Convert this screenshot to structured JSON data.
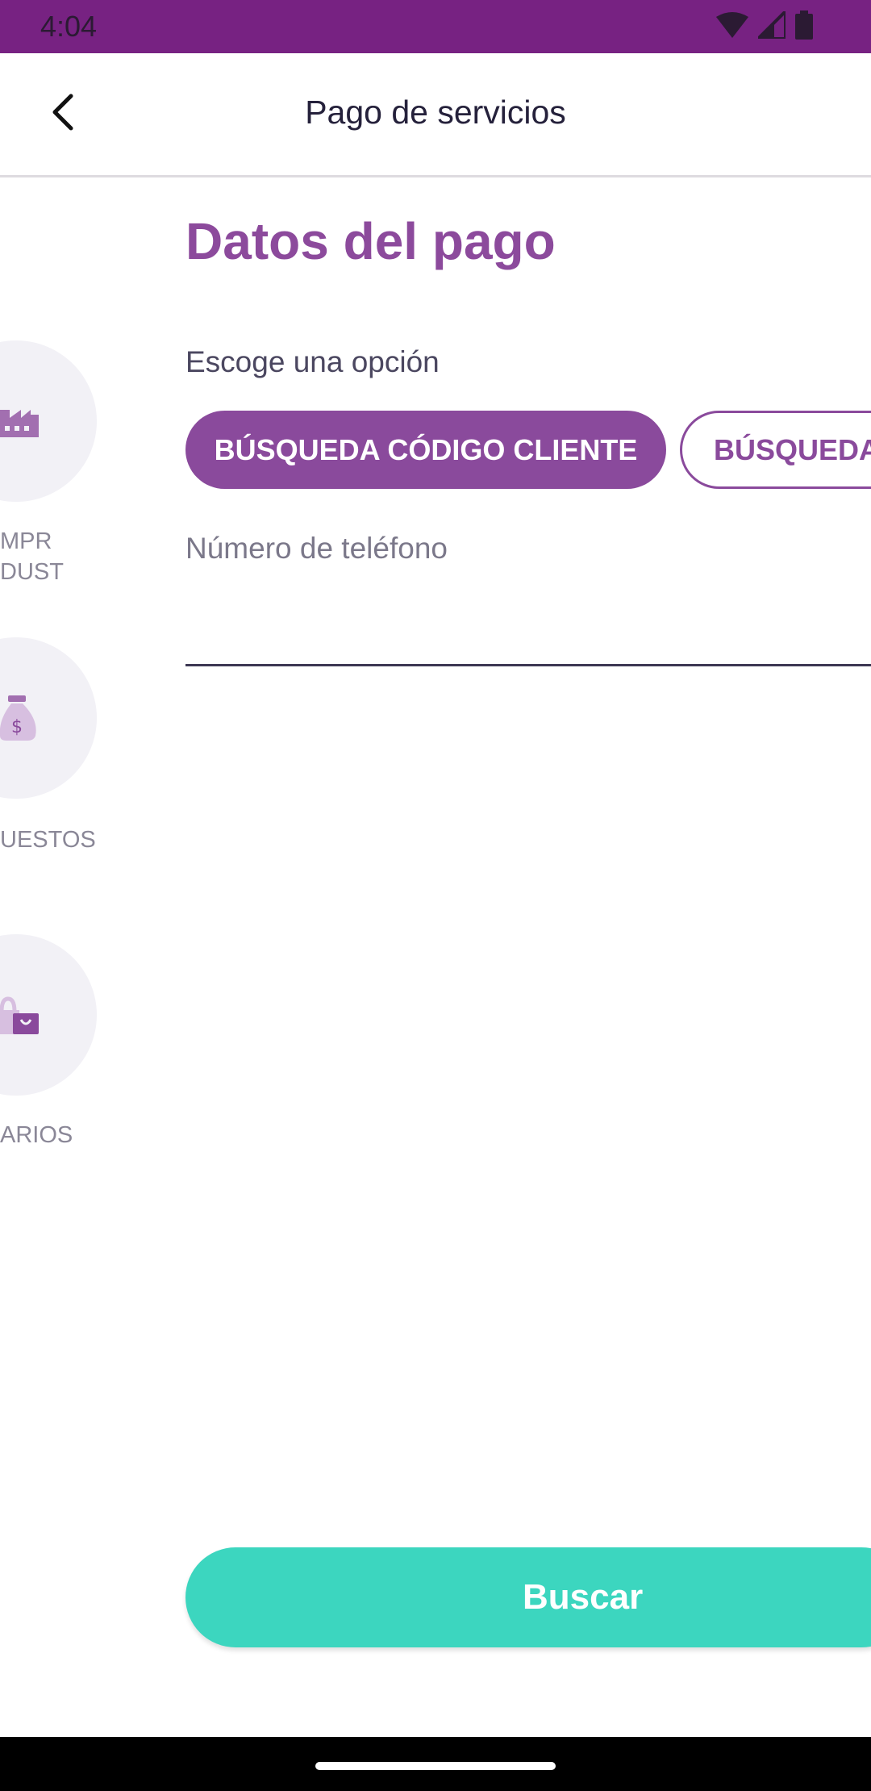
{
  "status_bar": {
    "time": "4:04",
    "icons": [
      "wifi-icon",
      "signal-icon",
      "battery-icon"
    ]
  },
  "app_bar": {
    "title": "Pago de servicios",
    "back_icon": "back-arrow-icon"
  },
  "categories": [
    {
      "icon": "factory-icon",
      "label_lines": [
        "MPR",
        "DUST"
      ]
    },
    {
      "icon": "money-bag-icon",
      "label_lines": [
        "UESTOS"
      ]
    },
    {
      "icon": "shopping-bag-icon",
      "label_lines": [
        "ARIOS"
      ]
    }
  ],
  "form": {
    "title": "Datos del pago",
    "choose_label": "Escoge una opción",
    "options": [
      {
        "label": "BÚSQUEDA CÓDIGO CLIENTE",
        "selected": true
      },
      {
        "label": "BÚSQUEDA",
        "selected": false
      }
    ],
    "phone_field": {
      "label": "Número de teléfono",
      "value": ""
    },
    "submit_label": "Buscar"
  },
  "colors": {
    "status_bar": "#772282",
    "primary": "#8a4a9c",
    "accent": "#3cd6bf",
    "category_circle": "#f2f1f6"
  }
}
